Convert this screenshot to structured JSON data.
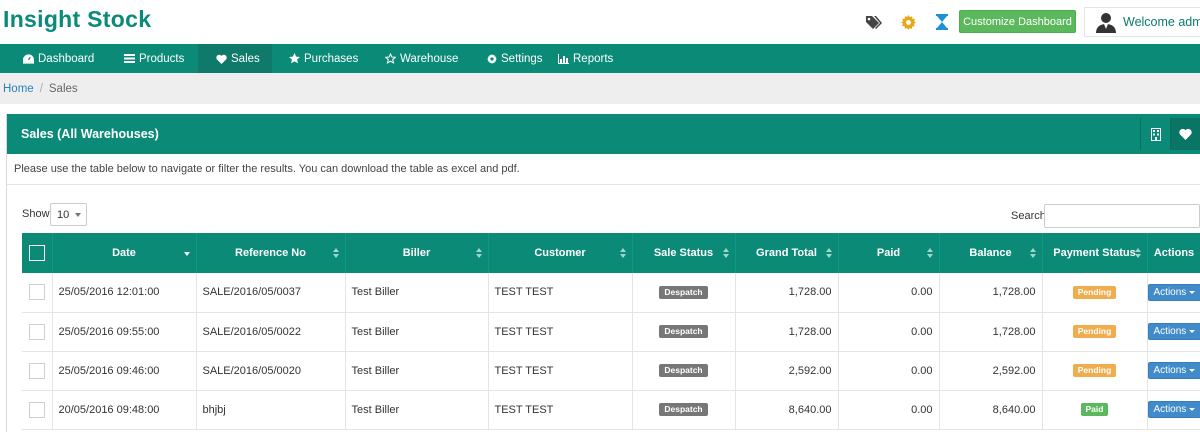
{
  "brand": "Insight Stock",
  "header": {
    "customize_label": "Customize Dashboard",
    "welcome": "Welcome admin",
    "icons": [
      "tags-icon",
      "gear-icon",
      "hourglass-icon",
      "user-avatar"
    ]
  },
  "nav": {
    "items": [
      {
        "label": "Dashboard",
        "icon": "dashboard-icon"
      },
      {
        "label": "Products",
        "icon": "list-icon"
      },
      {
        "label": "Sales",
        "icon": "heart-icon",
        "active": true
      },
      {
        "label": "Purchases",
        "icon": "star-icon"
      },
      {
        "label": "Warehouse",
        "icon": "star-outline-icon"
      },
      {
        "label": "Settings",
        "icon": "cog-icon"
      },
      {
        "label": "Reports",
        "icon": "bar-chart-icon"
      }
    ]
  },
  "breadcrumb": {
    "home": "Home",
    "current": "Sales"
  },
  "box": {
    "title": "Sales (All Warehouses)",
    "intro": "Please use the table below to navigate or filter the results. You can download the table as excel and pdf."
  },
  "controls": {
    "show_label": "Show",
    "show_value": "10",
    "search_label": "Search",
    "search_value": ""
  },
  "table": {
    "columns": [
      "",
      "Date",
      "Reference No",
      "Biller",
      "Customer",
      "Sale Status",
      "Grand Total",
      "Paid",
      "Balance",
      "Payment Status",
      "Actions"
    ],
    "rows": [
      {
        "date": "25/05/2016 12:01:00",
        "ref": "SALE/2016/05/0037",
        "biller": "Test Biller",
        "customer": "TEST TEST",
        "sale_status": "Despatch",
        "grand_total": "1,728.00",
        "paid": "0.00",
        "balance": "1,728.00",
        "payment_status": "Pending",
        "action": "Actions"
      },
      {
        "date": "25/05/2016 09:55:00",
        "ref": "SALE/2016/05/0022",
        "biller": "Test Biller",
        "customer": "TEST TEST",
        "sale_status": "Despatch",
        "grand_total": "1,728.00",
        "paid": "0.00",
        "balance": "1,728.00",
        "payment_status": "Pending",
        "action": "Actions"
      },
      {
        "date": "25/05/2016 09:46:00",
        "ref": "SALE/2016/05/0020",
        "biller": "Test Biller",
        "customer": "TEST TEST",
        "sale_status": "Despatch",
        "grand_total": "2,592.00",
        "paid": "0.00",
        "balance": "2,592.00",
        "payment_status": "Pending",
        "action": "Actions"
      },
      {
        "date": "20/05/2016 09:48:00",
        "ref": "bhjbj",
        "biller": "Test Biller",
        "customer": "TEST TEST",
        "sale_status": "Despatch",
        "grand_total": "8,640.00",
        "paid": "0.00",
        "balance": "8,640.00",
        "payment_status": "Paid",
        "action": "Actions"
      }
    ]
  },
  "colors": {
    "brand": "#0a8a78",
    "nav": "#0b8b77",
    "customize": "#5cb85c",
    "pending": "#f0ad4e",
    "paid": "#5cb85c",
    "despatch": "#777777",
    "actions": "#428bca"
  }
}
